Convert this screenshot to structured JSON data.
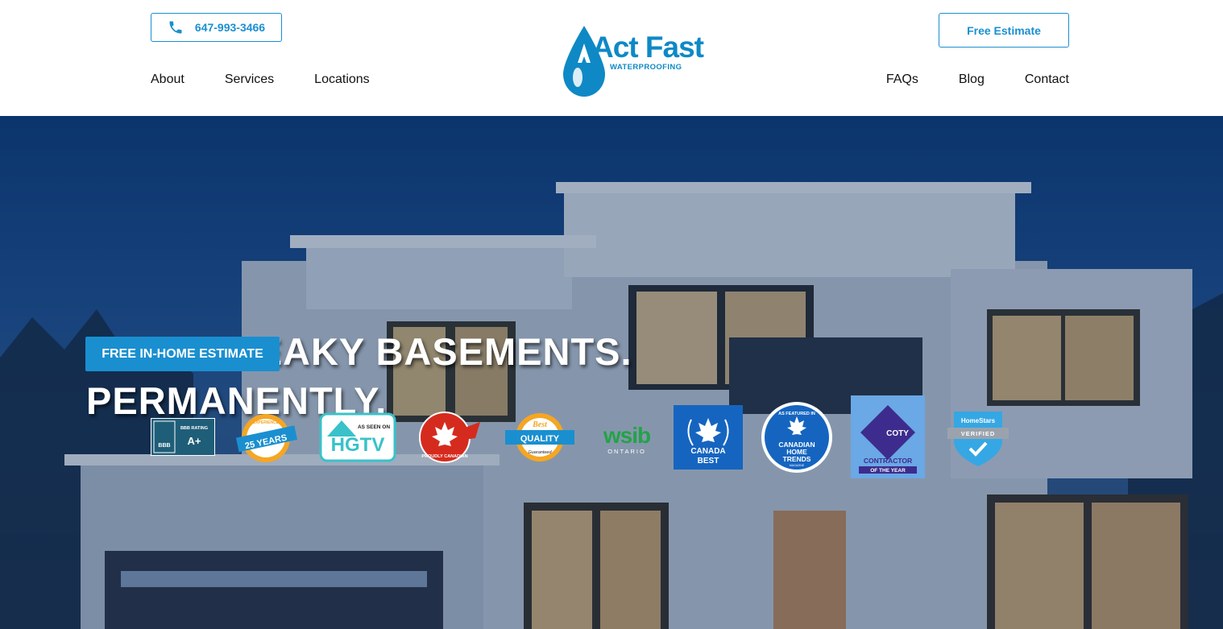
{
  "header": {
    "phone": "647-993-3466",
    "estimate_button": "Free Estimate",
    "logo": {
      "title": "Act Fast",
      "subtitle": "WATERPROOFING"
    },
    "nav_left": [
      "About",
      "Services",
      "Locations"
    ],
    "nav_right": [
      "FAQs",
      "Blog",
      "Contact"
    ]
  },
  "hero": {
    "title_line1": "WE FIX LEAKY BASEMENTS.",
    "title_line2": "PERMANENTLY.",
    "cta": "FREE IN-HOME ESTIMATE"
  },
  "badges": {
    "bbb": {
      "label": "BBB RATING",
      "grade": "A+",
      "mark": "BBB"
    },
    "years": {
      "top": "EXPERIENCE",
      "value": "25 YEARS"
    },
    "hgtv": {
      "small": "AS SEEN ON",
      "name": "HGTV"
    },
    "canadian": {
      "text": "PROUDLY CANADIAN"
    },
    "quality": {
      "top": "Best",
      "middle": "QUALITY",
      "bottom": "Guaranteed"
    },
    "wsib": {
      "name": "wsib",
      "region": "ONTARIO"
    },
    "canada_best": {
      "line1": "CANADA",
      "line2": "BEST"
    },
    "cht": {
      "ring": "AS FEATURED IN",
      "line1": "CANADIAN",
      "line2": "HOME",
      "line3": "TRENDS",
      "line4": "MAGAZINE"
    },
    "coty": {
      "mark": "COTY",
      "line1": "CONTRACTOR",
      "line2": "OF THE YEAR"
    },
    "homestars": {
      "top": "HomeStars",
      "status": "VERIFIED"
    }
  },
  "colors": {
    "accent": "#1a8fd0",
    "hero_dark": "#0c3a78"
  }
}
